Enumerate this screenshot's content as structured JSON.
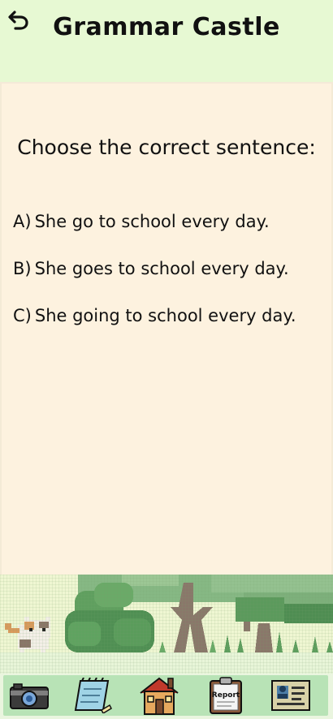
{
  "header": {
    "title": "Grammar Castle"
  },
  "quiz": {
    "question": "Choose the correct sentence:",
    "options": [
      {
        "letter": "A)",
        "text": "She go to school every day."
      },
      {
        "letter": "B)",
        "text": "She goes to school every day."
      },
      {
        "letter": "C)",
        "text": "She going to school every day."
      }
    ]
  },
  "nav": {
    "report_label": "Report",
    "items": [
      "camera-icon",
      "notebook-icon",
      "house-icon",
      "report-clipboard-icon",
      "profile-card-icon"
    ]
  },
  "colors": {
    "header_bg": "#e7f9d3",
    "content_bg": "#fdf2df",
    "nav_strip": "#b8e3b6",
    "text": "#111111"
  }
}
